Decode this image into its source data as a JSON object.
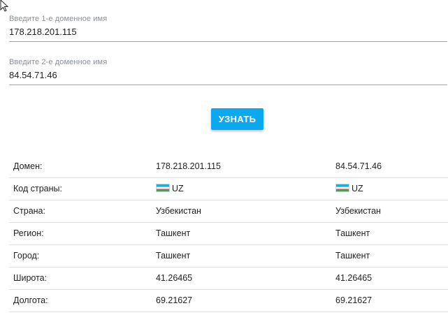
{
  "form": {
    "domain1": {
      "label": "Введите 1-е доменное имя",
      "value": "178.218.201.115"
    },
    "domain2": {
      "label": "Введите 2-е доменное имя",
      "value": "84.54.71.46"
    },
    "submit_label": "УЗНАТЬ",
    "accent_color": "#08a9ee"
  },
  "results": {
    "rows": [
      {
        "label": "Домен:",
        "v1": "178.218.201.115",
        "v2": "84.54.71.46"
      },
      {
        "label": "Код страны:",
        "v1": "UZ",
        "v2": "UZ",
        "icon": "uzbekistan-flag-icon"
      },
      {
        "label": "Страна:",
        "v1": "Узбекистан",
        "v2": "Узбекистан"
      },
      {
        "label": "Регион:",
        "v1": "Ташкент",
        "v2": "Ташкент"
      },
      {
        "label": "Город:",
        "v1": "Ташкент",
        "v2": "Ташкент"
      },
      {
        "label": "Широта:",
        "v1": "41.26465",
        "v2": "41.26465"
      },
      {
        "label": "Долгота:",
        "v1": "69.21627",
        "v2": "69.21627"
      }
    ]
  }
}
